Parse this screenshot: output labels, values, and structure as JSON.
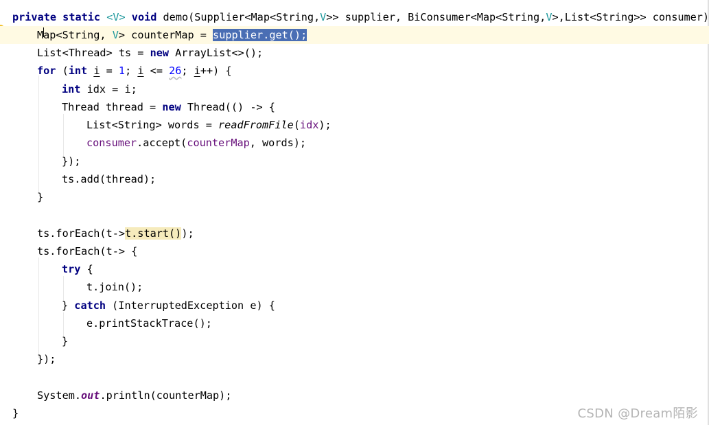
{
  "code": {
    "l1": [
      "private",
      "static",
      "<V>",
      "void",
      "demo(Supplier<Map<String,",
      "V",
      ">> supplier, BiConsumer<Map<String,",
      "V",
      ">,List<String>> consumer) {"
    ],
    "l2": [
      "Map<String, ",
      "V",
      "> counterMap = ",
      "supplier.get()",
      ";"
    ],
    "l3": [
      "List<Thread> ts = ",
      "new",
      " ArrayList<>();"
    ],
    "l4": [
      "for",
      " (",
      "int",
      " ",
      "i",
      " = ",
      "1",
      "; ",
      "i",
      " <= ",
      "26",
      "; ",
      "i",
      "++) {"
    ],
    "l5": [
      "int",
      " idx = i;"
    ],
    "l6": [
      "Thread thread = ",
      "new",
      " Thread(() -> {"
    ],
    "l7": [
      "List<String> words = ",
      "readFromFile",
      "(",
      "idx",
      ");"
    ],
    "l8": [
      "consumer",
      ".accept(",
      "counterMap",
      ", words);"
    ],
    "l9": "});",
    "l10": "ts.add(thread);",
    "l11": "}",
    "l12": [
      "ts.forEach(t->",
      "t.start()",
      ");"
    ],
    "l13": "ts.forEach(t-> {",
    "l14": [
      "try",
      " {"
    ],
    "l15": "t.join();",
    "l16": [
      "} ",
      "catch",
      " (InterruptedException e) {"
    ],
    "l17": "e.printStackTrace();",
    "l18": "}",
    "l19": "});",
    "l20": [
      "System.",
      "out",
      ".println(counterMap);"
    ],
    "l21": "}"
  },
  "watermark": "CSDN @Dream陌影",
  "icons": {
    "gutter": "intention-bulb-icon"
  },
  "colors": {
    "keyword": "#000080",
    "type_param": "#20999d",
    "field": "#660e7a",
    "number": "#0000ff",
    "selection": "#214283",
    "current_line": "#fffae3"
  }
}
